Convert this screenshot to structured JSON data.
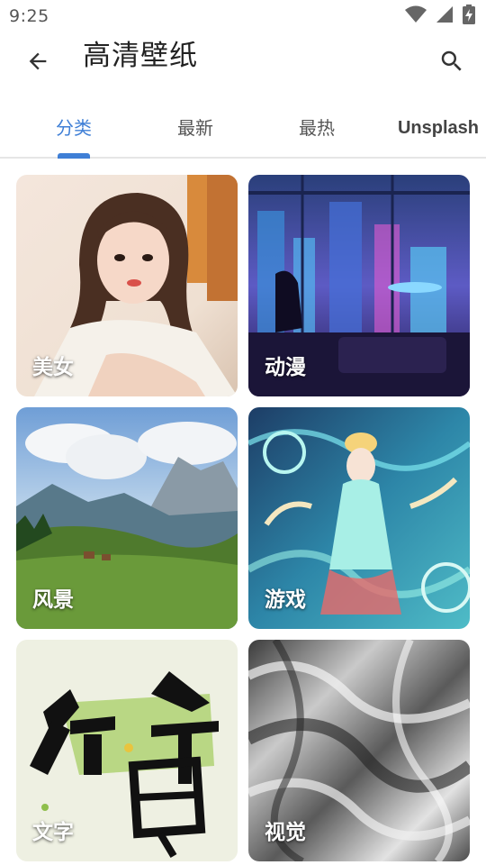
{
  "status_bar": {
    "time": "9:25"
  },
  "app_bar": {
    "title": "高清壁纸"
  },
  "tabs": [
    {
      "label": "分类",
      "active": true
    },
    {
      "label": "最新",
      "active": false
    },
    {
      "label": "最热",
      "active": false
    },
    {
      "label": "Unsplash",
      "active": false
    }
  ],
  "categories": [
    {
      "label": "美女"
    },
    {
      "label": "动漫"
    },
    {
      "label": "风景"
    },
    {
      "label": "游戏"
    },
    {
      "label": "文字"
    },
    {
      "label": "视觉"
    }
  ],
  "colors": {
    "accent": "#3f7fd6"
  }
}
